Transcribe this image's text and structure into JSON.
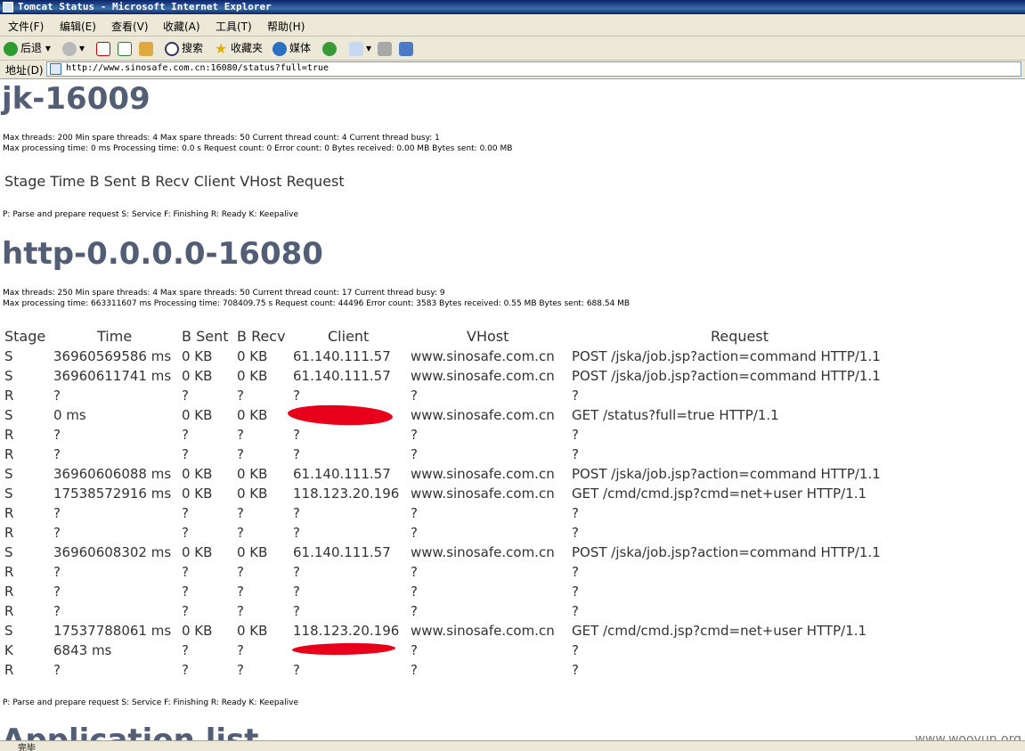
{
  "window": {
    "title": "Tomcat Status - Microsoft Internet Explorer"
  },
  "menu": [
    "文件(F)",
    "编辑(E)",
    "查看(V)",
    "收藏(A)",
    "工具(T)",
    "帮助(H)"
  ],
  "toolbar": {
    "back": "后退",
    "search": "搜索",
    "favorites": "收藏夹",
    "media": "媒体"
  },
  "address": {
    "label": "地址(D)",
    "url": "http://www.sinosafe.com.cn:16080/status?full=true"
  },
  "section1": {
    "title": "jk-16009",
    "line1": "Max threads: 200 Min spare threads: 4 Max spare threads: 50 Current thread count: 4 Current thread busy: 1",
    "line2": "Max processing time: 0 ms Processing time: 0.0 s Request count: 0 Error count: 0 Bytes received: 0.00 MB Bytes sent: 0.00 MB",
    "header_row": "Stage Time B Sent B Recv Client VHost Request",
    "legend": "P: Parse and prepare request S: Service F: Finishing R: Ready K: Keepalive"
  },
  "section2": {
    "title": "http-0.0.0.0-16080",
    "line1": "Max threads: 250 Min spare threads: 4 Max spare threads: 50 Current thread count: 17 Current thread busy: 9",
    "line2": "Max processing time: 663311607 ms Processing time: 708409.75 s Request count: 44496 Error count: 3583 Bytes received: 0.55 MB Bytes sent: 688.54 MB",
    "columns": [
      "Stage",
      "Time",
      "B Sent",
      "B Recv",
      "Client",
      "VHost",
      "Request"
    ],
    "rows": [
      [
        "S",
        "36960569586 ms",
        "0 KB",
        "0 KB",
        "61.140.111.57",
        "www.sinosafe.com.cn",
        "POST /jska/job.jsp?action=command HTTP/1.1"
      ],
      [
        "S",
        "36960611741 ms",
        "0 KB",
        "0 KB",
        "61.140.111.57",
        "www.sinosafe.com.cn",
        "POST /jska/job.jsp?action=command HTTP/1.1"
      ],
      [
        "R",
        "?",
        "?",
        "?",
        "?",
        "?",
        "?"
      ],
      [
        "S",
        "0 ms",
        "0 KB",
        "0 KB",
        "",
        "www.sinosafe.com.cn",
        "GET /status?full=true HTTP/1.1"
      ],
      [
        "R",
        "?",
        "?",
        "?",
        "?",
        "?",
        "?"
      ],
      [
        "R",
        "?",
        "?",
        "?",
        "?",
        "?",
        "?"
      ],
      [
        "S",
        "36960606088 ms",
        "0 KB",
        "0 KB",
        "61.140.111.57",
        "www.sinosafe.com.cn",
        "POST /jska/job.jsp?action=command HTTP/1.1"
      ],
      [
        "S",
        "17538572916 ms",
        "0 KB",
        "0 KB",
        "118.123.20.196",
        "www.sinosafe.com.cn",
        "GET /cmd/cmd.jsp?cmd=net+user HTTP/1.1"
      ],
      [
        "R",
        "?",
        "?",
        "?",
        "?",
        "?",
        "?"
      ],
      [
        "R",
        "?",
        "?",
        "?",
        "?",
        "?",
        "?"
      ],
      [
        "S",
        "36960608302 ms",
        "0 KB",
        "0 KB",
        "61.140.111.57",
        "www.sinosafe.com.cn",
        "POST /jska/job.jsp?action=command HTTP/1.1"
      ],
      [
        "R",
        "?",
        "?",
        "?",
        "?",
        "?",
        "?"
      ],
      [
        "R",
        "?",
        "?",
        "?",
        "?",
        "?",
        "?"
      ],
      [
        "R",
        "?",
        "?",
        "?",
        "?",
        "?",
        "?"
      ],
      [
        "S",
        "17537788061 ms",
        "0 KB",
        "0 KB",
        "118.123.20.196",
        "www.sinosafe.com.cn",
        "GET /cmd/cmd.jsp?cmd=net+user HTTP/1.1"
      ],
      [
        "K",
        "6843 ms",
        "?",
        "?",
        "",
        "?",
        "?"
      ],
      [
        "R",
        "?",
        "?",
        "?",
        "?",
        "?",
        "?"
      ]
    ],
    "legend": "P: Parse and prepare request S: Service F: Finishing R: Ready K: Keepalive"
  },
  "section3": {
    "title": "Application list"
  },
  "statusbar": {
    "text": "完毕"
  },
  "watermark": "www.wooyun.org",
  "colors": {
    "heading": "#525d76",
    "redaction": "#e8001a",
    "titlebar": "#0a246a"
  }
}
